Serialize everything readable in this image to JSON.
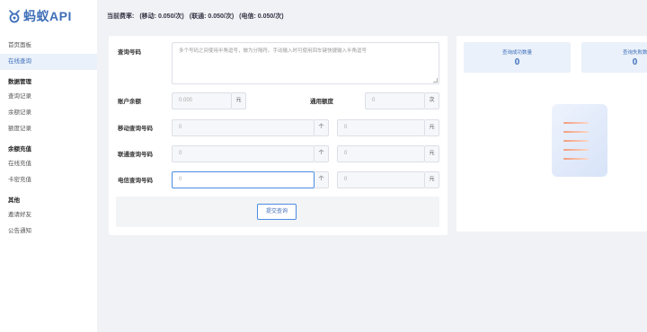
{
  "app": {
    "logo_text": "蚂蚁API"
  },
  "topbar": {
    "rate_label": "当前费率:",
    "mobile": "(移动: 0.050/次)",
    "unicom": "(联通: 0.050/次)",
    "telecom": "(电信: 0.050/次)"
  },
  "sidebar": {
    "items": [
      {
        "label": "首页面板"
      },
      {
        "label": "在线查询"
      }
    ],
    "groups": [
      {
        "title": "数据管理",
        "items": [
          {
            "label": "查询记录"
          },
          {
            "label": "余额记录"
          },
          {
            "label": "额度记录"
          }
        ]
      },
      {
        "title": "余额充值",
        "items": [
          {
            "label": "在线充值"
          },
          {
            "label": "卡密充值"
          }
        ]
      },
      {
        "title": "其他",
        "items": [
          {
            "label": "邀请好友"
          },
          {
            "label": "公告通知"
          }
        ]
      }
    ]
  },
  "form": {
    "query_label": "查询号码",
    "query_placeholder": "多个号码之间使用半角逗号，做为分隔符。手动输入时可使用回车键快捷输入半角逗号",
    "balance_label": "账户余额",
    "balance_value": "0.000",
    "balance_unit": "元",
    "quota_label": "通用额度",
    "quota_value": "0",
    "quota_unit": "次",
    "mobile_label": "移动查询号码",
    "unicom_label": "联通查询号码",
    "telecom_label": "电信查询号码",
    "count_value": "0",
    "count_unit": "个",
    "cost_value": "0",
    "cost_unit": "元",
    "submit_label": "提交查询"
  },
  "stats": {
    "success_label": "查询成功数量",
    "success_value": "0",
    "fail_label": "查询失败数量",
    "fail_value": "0"
  },
  "colors": {
    "accent": "#3f6fb8",
    "focus": "#4a8be0",
    "page_bg": "#f1f2f5"
  }
}
